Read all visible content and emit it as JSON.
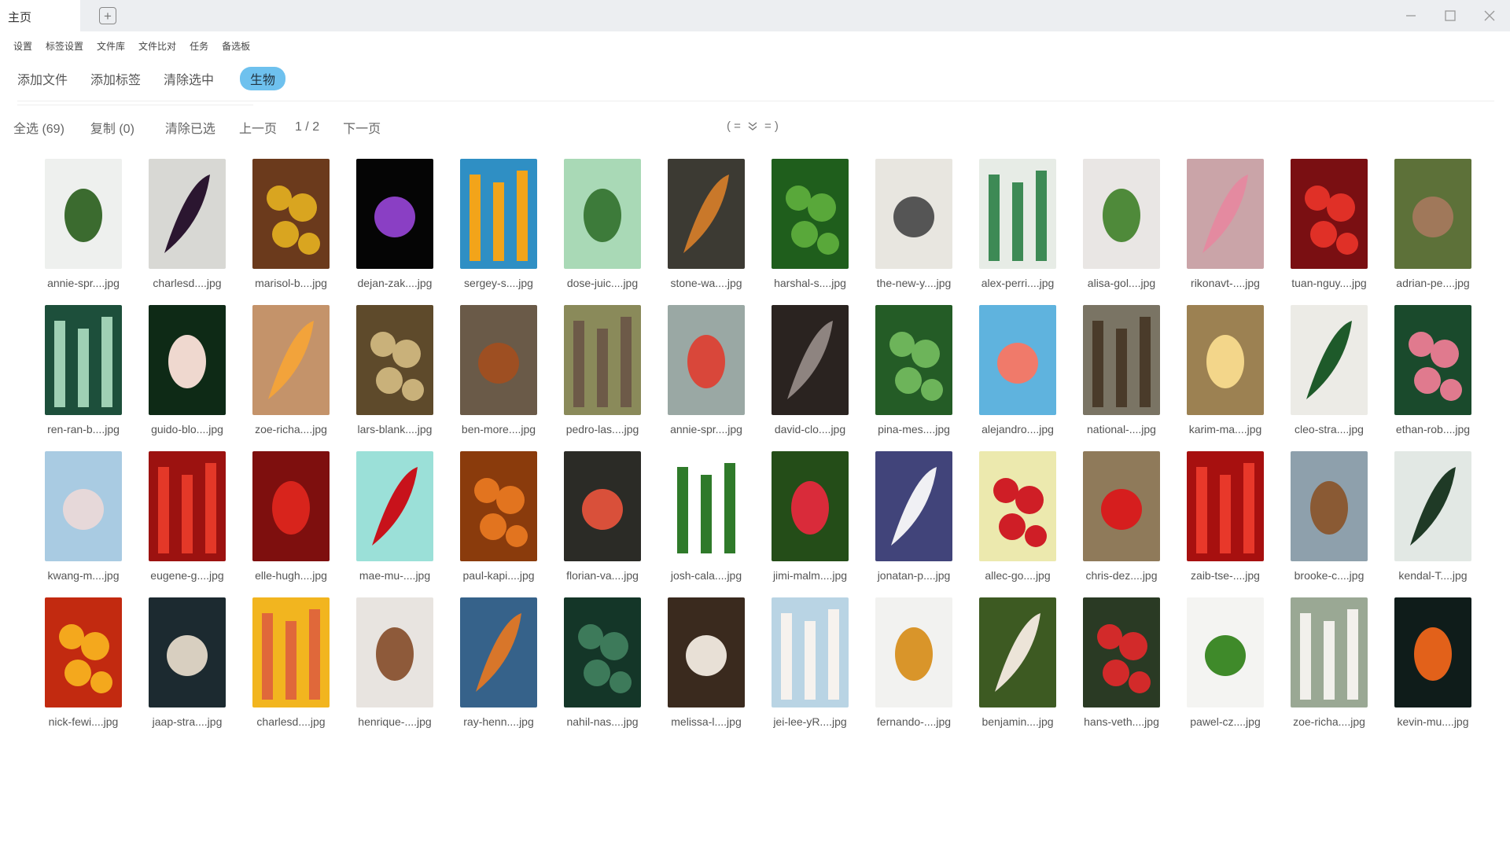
{
  "window": {
    "tab_label": "主页"
  },
  "menu": [
    "设置",
    "标签设置",
    "文件库",
    "文件比对",
    "任务",
    "备选板"
  ],
  "toolbar": {
    "add_file": "添加文件",
    "add_tag": "添加标签",
    "clear_selected": "清除选中",
    "active_tag": "生物"
  },
  "actions": {
    "select_all": "全选 (69)",
    "copy": "复制 (0)",
    "clear_chosen": "清除已选",
    "prev_page": "上一页",
    "page_indicator": "1 / 2",
    "next_page": "下一页",
    "sort_left": "( =",
    "sort_right": "= )"
  },
  "colors": {
    "accent_chip": "#6ec1ee",
    "titlebar_bg": "#eceef1"
  },
  "files": [
    {
      "name": "annie-spr....jpg",
      "bg": "#eef0ee",
      "fg": "#3b6b2f"
    },
    {
      "name": "charlesd....jpg",
      "bg": "#d8d8d4",
      "fg": "#2b1630"
    },
    {
      "name": "marisol-b....jpg",
      "bg": "#6b3a1c",
      "fg": "#d9a520"
    },
    {
      "name": "dejan-zak....jpg",
      "bg": "#050505",
      "fg": "#8a3fc4"
    },
    {
      "name": "sergey-s....jpg",
      "bg": "#2f8fc4",
      "fg": "#f2a41a"
    },
    {
      "name": "dose-juic....jpg",
      "bg": "#a9d9b6",
      "fg": "#3d7b3a"
    },
    {
      "name": "stone-wa....jpg",
      "bg": "#3c3a33",
      "fg": "#c9782a"
    },
    {
      "name": "harshal-s....jpg",
      "bg": "#1f5e1c",
      "fg": "#59a83a"
    },
    {
      "name": "the-new-y....jpg",
      "bg": "#e8e6e0",
      "fg": "#555555"
    },
    {
      "name": "alex-perri....jpg",
      "bg": "#e7ece6",
      "fg": "#3d8a55"
    },
    {
      "name": "alisa-gol....jpg",
      "bg": "#e9e6e4",
      "fg": "#4f8a3a"
    },
    {
      "name": "rikonavt-....jpg",
      "bg": "#caa4a8",
      "fg": "#e48aa0"
    },
    {
      "name": "tuan-nguy....jpg",
      "bg": "#7a0f12",
      "fg": "#e03027"
    },
    {
      "name": "adrian-pe....jpg",
      "bg": "#5d7139",
      "fg": "#a0785a"
    },
    {
      "name": "ren-ran-b....jpg",
      "bg": "#1d4f3b",
      "fg": "#9fd0b4"
    },
    {
      "name": "guido-blo....jpg",
      "bg": "#0e2a16",
      "fg": "#efd8cf"
    },
    {
      "name": "zoe-richa....jpg",
      "bg": "#c4936a",
      "fg": "#f2a33b"
    },
    {
      "name": "lars-blank....jpg",
      "bg": "#5e4a2b",
      "fg": "#c9b17a"
    },
    {
      "name": "ben-more....jpg",
      "bg": "#6a5a48",
      "fg": "#9e4f22"
    },
    {
      "name": "pedro-las....jpg",
      "bg": "#8a8a5a",
      "fg": "#6d5a48"
    },
    {
      "name": "annie-spr....jpg",
      "bg": "#9aa8a4",
      "fg": "#d9473a"
    },
    {
      "name": "david-clo....jpg",
      "bg": "#2a2320",
      "fg": "#8e8480"
    },
    {
      "name": "pina-mes....jpg",
      "bg": "#245c26",
      "fg": "#6db45a"
    },
    {
      "name": "alejandro....jpg",
      "bg": "#5fb3de",
      "fg": "#f07a6a"
    },
    {
      "name": "national-....jpg",
      "bg": "#7a7464",
      "fg": "#4a3b2a"
    },
    {
      "name": "karim-ma....jpg",
      "bg": "#9c8152",
      "fg": "#f3d68a"
    },
    {
      "name": "cleo-stra....jpg",
      "bg": "#ecebe6",
      "fg": "#1e5a2a"
    },
    {
      "name": "ethan-rob....jpg",
      "bg": "#1a4a2c",
      "fg": "#e07a8e"
    },
    {
      "name": "kwang-m....jpg",
      "bg": "#a9cbe2",
      "fg": "#e6d8d9"
    },
    {
      "name": "eugene-g....jpg",
      "bg": "#9c1210",
      "fg": "#e43828"
    },
    {
      "name": "elle-hugh....jpg",
      "bg": "#7e0f0e",
      "fg": "#d8241c"
    },
    {
      "name": "mae-mu-....jpg",
      "bg": "#9be0d8",
      "fg": "#c8121b"
    },
    {
      "name": "paul-kapi....jpg",
      "bg": "#8a3b0c",
      "fg": "#e2741f"
    },
    {
      "name": "florian-va....jpg",
      "bg": "#2b2b26",
      "fg": "#d9503a"
    },
    {
      "name": "josh-cala....jpg",
      "bg": "#ffffff",
      "fg": "#2f7a2a"
    },
    {
      "name": "jimi-malm....jpg",
      "bg": "#244d18",
      "fg": "#d92b3a"
    },
    {
      "name": "jonatan-p....jpg",
      "bg": "#41447a",
      "fg": "#f0f0f4"
    },
    {
      "name": "allec-go....jpg",
      "bg": "#ece9ae",
      "fg": "#cf1e26"
    },
    {
      "name": "chris-dez....jpg",
      "bg": "#8f7a5a",
      "fg": "#d61e1e"
    },
    {
      "name": "zaib-tse-....jpg",
      "bg": "#a7100f",
      "fg": "#e8382a"
    },
    {
      "name": "brooke-c....jpg",
      "bg": "#8ea0ac",
      "fg": "#8a5a34"
    },
    {
      "name": "kendal-T....jpg",
      "bg": "#e2e8e4",
      "fg": "#1f3a26"
    },
    {
      "name": "nick-fewi....jpg",
      "bg": "#c22a10",
      "fg": "#f4a81d"
    },
    {
      "name": "jaap-stra....jpg",
      "bg": "#1c2a30",
      "fg": "#d8cfc0"
    },
    {
      "name": "charlesd....jpg",
      "bg": "#f2b51f",
      "fg": "#e0683a"
    },
    {
      "name": "henrique-....jpg",
      "bg": "#e8e4e0",
      "fg": "#8e5a3a"
    },
    {
      "name": "ray-henn....jpg",
      "bg": "#36628a",
      "fg": "#d8762a"
    },
    {
      "name": "nahil-nas....jpg",
      "bg": "#143628",
      "fg": "#3d7a5a"
    },
    {
      "name": "melissa-l....jpg",
      "bg": "#3a2a1e",
      "fg": "#e8e0d6"
    },
    {
      "name": "jei-lee-yR....jpg",
      "bg": "#b9d4e4",
      "fg": "#f6f2ee"
    },
    {
      "name": "fernando-....jpg",
      "bg": "#f2f2f0",
      "fg": "#d9952a"
    },
    {
      "name": "benjamin....jpg",
      "bg": "#3d5a22",
      "fg": "#ece4d8"
    },
    {
      "name": "hans-veth....jpg",
      "bg": "#2a3a24",
      "fg": "#d22a2a"
    },
    {
      "name": "pawel-cz....jpg",
      "bg": "#f4f4f2",
      "fg": "#3f8a2a"
    },
    {
      "name": "zoe-richa....jpg",
      "bg": "#9aa894",
      "fg": "#f2f0ec"
    },
    {
      "name": "kevin-mu....jpg",
      "bg": "#0f1c1a",
      "fg": "#e2611a"
    }
  ]
}
